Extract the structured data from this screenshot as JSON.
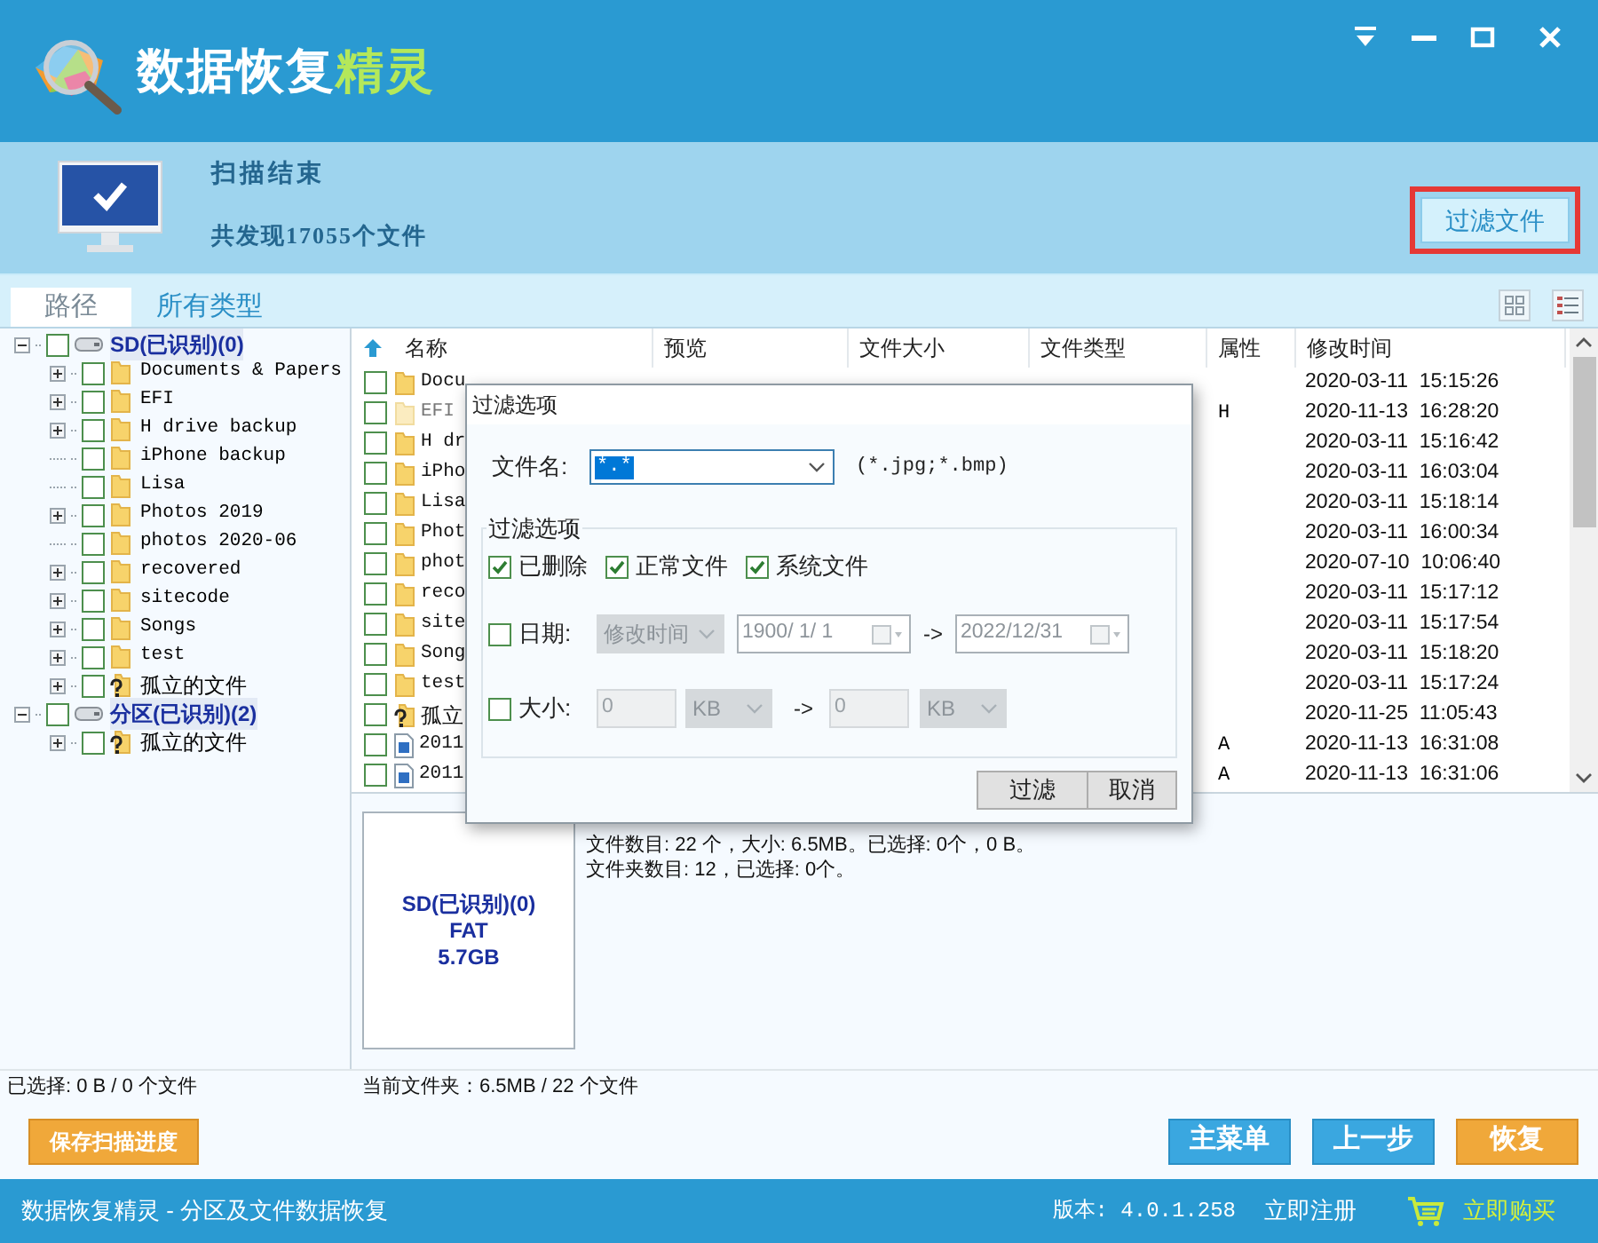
{
  "window": {
    "title_main": "数据恢复",
    "title_accent": "精灵"
  },
  "scan": {
    "status": "扫描结束",
    "summary": "共发现17055个文件",
    "filter_button": "过滤文件",
    "highlighted": true
  },
  "tabs": [
    {
      "label": "路径",
      "selected": true
    },
    {
      "label": "所有类型",
      "selected": false
    }
  ],
  "tree": [
    {
      "label": "SD(已识别)(0)",
      "kind": "drive",
      "expanded": true,
      "checked": false,
      "children": [
        {
          "label": "Documents & Papers",
          "kind": "folder",
          "expanded": false,
          "checked": false
        },
        {
          "label": "EFI",
          "kind": "folder",
          "expanded": false,
          "checked": false
        },
        {
          "label": "H drive backup",
          "kind": "folder",
          "expanded": false,
          "checked": false
        },
        {
          "label": "iPhone backup",
          "kind": "folder",
          "checked": false
        },
        {
          "label": "Lisa",
          "kind": "folder",
          "checked": false
        },
        {
          "label": "Photos 2019",
          "kind": "folder",
          "expanded": false,
          "checked": false
        },
        {
          "label": "photos 2020-06",
          "kind": "folder",
          "checked": false
        },
        {
          "label": "recovered",
          "kind": "folder",
          "expanded": false,
          "checked": false
        },
        {
          "label": "sitecode",
          "kind": "folder",
          "expanded": false,
          "checked": false
        },
        {
          "label": "Songs",
          "kind": "folder",
          "expanded": false,
          "checked": false
        },
        {
          "label": "test",
          "kind": "folder",
          "expanded": false,
          "checked": false
        },
        {
          "label": "孤立的文件",
          "kind": "orphan",
          "expanded": false,
          "checked": false
        }
      ]
    },
    {
      "label": "分区(已识别)(2)",
      "kind": "drive",
      "expanded": true,
      "checked": false,
      "children": [
        {
          "label": "孤立的文件",
          "kind": "orphan",
          "expanded": false,
          "checked": false
        }
      ]
    }
  ],
  "table": {
    "columns": [
      "名称",
      "预览",
      "文件大小",
      "文件类型",
      "属性",
      "修改时间"
    ],
    "rows": [
      {
        "name": "Docu",
        "kind": "folder",
        "checked": false,
        "time": "2020-03-11  15:15:26"
      },
      {
        "name": "EFI",
        "kind": "hidden",
        "checked": false,
        "attribute": "H",
        "time": "2020-11-13  16:28:20"
      },
      {
        "name": "H dr",
        "kind": "folder",
        "checked": false,
        "time": "2020-03-11  15:16:42"
      },
      {
        "name": "iPho",
        "kind": "folder",
        "checked": false,
        "time": "2020-03-11  16:03:04"
      },
      {
        "name": "Lisa",
        "kind": "folder",
        "checked": false,
        "time": "2020-03-11  15:18:14"
      },
      {
        "name": "Phot",
        "kind": "folder",
        "checked": false,
        "time": "2020-03-11  16:00:34"
      },
      {
        "name": "phot",
        "kind": "folder",
        "checked": false,
        "time": "2020-07-10  10:06:40"
      },
      {
        "name": "reco",
        "kind": "folder",
        "checked": false,
        "time": "2020-03-11  15:17:12"
      },
      {
        "name": "site",
        "kind": "folder",
        "checked": false,
        "time": "2020-03-11  15:17:54"
      },
      {
        "name": "Song",
        "kind": "folder",
        "checked": false,
        "time": "2020-03-11  15:18:20"
      },
      {
        "name": "test",
        "kind": "folder",
        "checked": false,
        "time": "2020-03-11  15:17:24"
      },
      {
        "name": "孤立",
        "kind": "orphan",
        "checked": false,
        "time": "2020-11-25  11:05:43"
      },
      {
        "name": "2011",
        "kind": "file",
        "checked": false,
        "attribute": "A",
        "time": "2020-11-13  16:31:08"
      },
      {
        "name": "2011",
        "kind": "file",
        "checked": false,
        "attribute": "A",
        "time": "2020-11-13  16:31:06"
      }
    ]
  },
  "details": {
    "drive_name": "SD(已识别)(0)",
    "filesystem": "FAT",
    "capacity": "5.7GB",
    "lines": [
      "文件数目: 22 个，大小: 6.5MB。已选择: 0个，0 B。",
      "文件夹数目: 12，已选择: 0个。"
    ]
  },
  "status": {
    "selected": "已选择: 0 B / 0 个文件",
    "current_folder": "当前文件夹：6.5MB / 22 个文件"
  },
  "buttons": [
    {
      "label": "保存扫描进度",
      "kind": "accent"
    },
    {
      "label": "主菜单",
      "kind": "primary"
    },
    {
      "label": "上一步",
      "kind": "primary"
    },
    {
      "label": "恢复",
      "kind": "accent"
    }
  ],
  "footer": {
    "app": "数据恢复精灵 - 分区及文件数据恢复",
    "version": "版本: 4.0.1.258",
    "register": "立即注册",
    "buy": "立即购买"
  },
  "dialog": {
    "title": "过滤选项",
    "filename_label": "文件名:",
    "filename_value": "*.*",
    "filename_hint": "(*.jpg;*.bmp)",
    "group_label": "过滤选项",
    "file_types": [
      {
        "label": "已删除",
        "checked": true
      },
      {
        "label": "正常文件",
        "checked": true
      },
      {
        "label": "系统文件",
        "checked": true
      }
    ],
    "date": {
      "label": "日期:",
      "checked": false,
      "field": "修改时间",
      "from": "1900/ 1/ 1",
      "arrow": "->",
      "to": "2022/12/31"
    },
    "size": {
      "label": "大小:",
      "checked": false,
      "from": "0",
      "from_unit": "KB",
      "arrow": "->",
      "to": "0",
      "to_unit": "KB"
    },
    "buttons": [
      "过滤",
      "取消"
    ]
  }
}
